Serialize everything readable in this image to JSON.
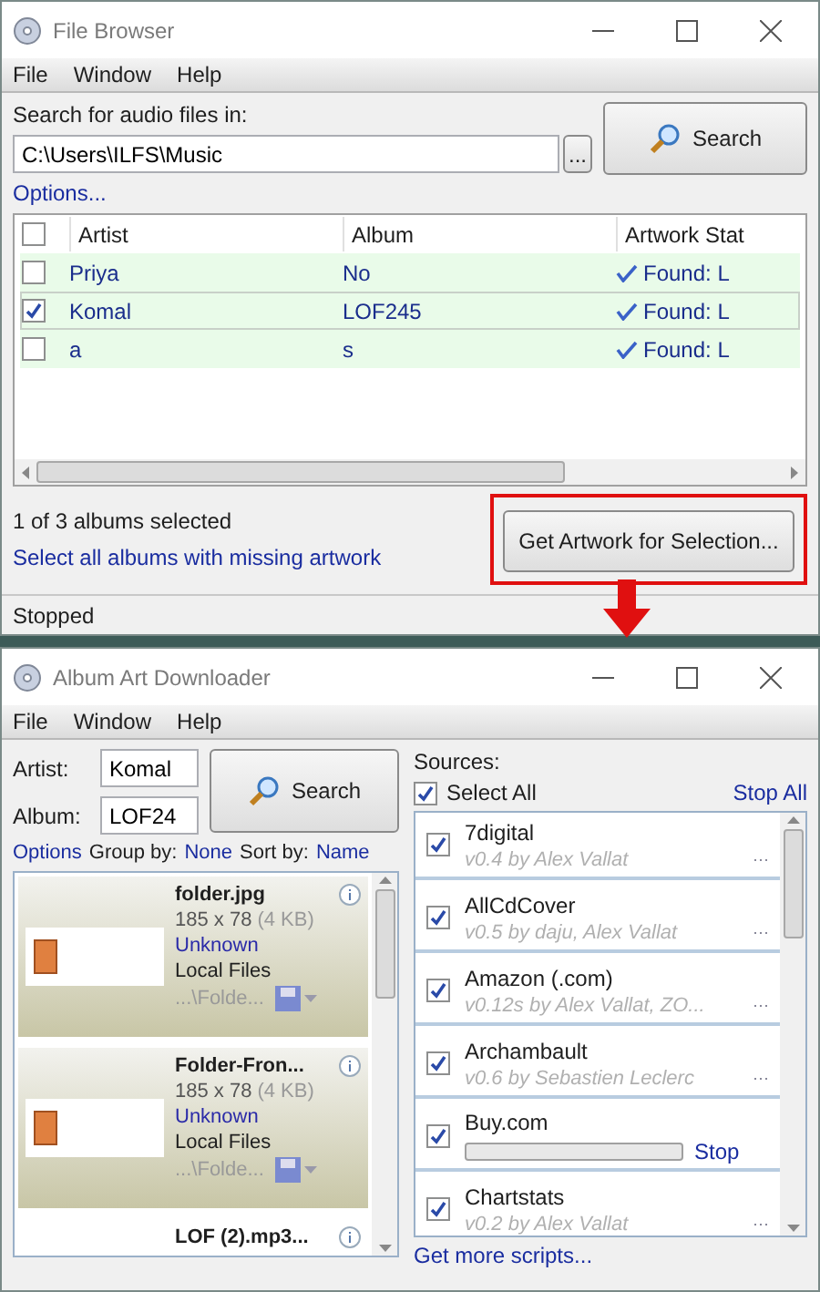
{
  "file_browser": {
    "title": "File Browser",
    "menu": [
      "File",
      "Window",
      "Help"
    ],
    "search_label": "Search for audio files in:",
    "path": "C:\\Users\\ILFS\\Music",
    "browse_button": "...",
    "search_button": "Search",
    "options_link": "Options...",
    "table": {
      "all_checked": false,
      "columns": [
        "Artist",
        "Album",
        "Artwork Stat"
      ],
      "rows": [
        {
          "checked": false,
          "artist": "Priya",
          "album": "No",
          "status": "Found: L"
        },
        {
          "checked": true,
          "artist": "Komal",
          "album": "LOF245",
          "status": "Found: L"
        },
        {
          "checked": false,
          "artist": "a",
          "album": "s",
          "status": "Found: L"
        }
      ]
    },
    "selection_count": "1 of 3 albums selected",
    "select_missing_link": "Select all albums with missing artwork",
    "get_artwork_button": "Get Artwork for Selection...",
    "status_bar": "Stopped"
  },
  "album_art_downloader": {
    "title": "Album Art Downloader",
    "menu": [
      "File",
      "Window",
      "Help"
    ],
    "artist_label": "Artist:",
    "artist_value": "Komal",
    "album_label": "Album:",
    "album_value": "LOF24",
    "search_button": "Search",
    "options_link": "Options",
    "group_by_label": "Group by:",
    "group_by_value": "None",
    "sort_by_label": "Sort by:",
    "sort_by_value": "Name",
    "results": [
      {
        "name": "folder.jpg",
        "dimensions": "185 x 78",
        "size": "(4 KB)",
        "type": "Unknown",
        "source": "Local Files",
        "path": "...\\Folde..."
      },
      {
        "name": "Folder-Fron...",
        "dimensions": "185 x 78",
        "size": "(4 KB)",
        "type": "Unknown",
        "source": "Local Files",
        "path": "...\\Folde..."
      },
      {
        "name": "LOF (2).mp3..."
      }
    ],
    "sources_label": "Sources:",
    "select_all": {
      "label": "Select All",
      "checked": true
    },
    "stop_all_link": "Stop All",
    "sources": [
      {
        "kind": "info",
        "checked": true,
        "name": "7digital",
        "detail": "v0.4 by Alex Vallat"
      },
      {
        "kind": "info",
        "checked": true,
        "name": "AllCdCover",
        "detail": "v0.5 by daju, Alex Vallat"
      },
      {
        "kind": "info",
        "checked": true,
        "name": "Amazon (.com)",
        "detail": "v0.12s by Alex Vallat, ZO..."
      },
      {
        "kind": "info",
        "checked": true,
        "name": "Archambault",
        "detail": "v0.6 by Sebastien Leclerc"
      },
      {
        "kind": "progress",
        "checked": true,
        "name": "Buy.com",
        "level": 0,
        "stop_link": "Stop"
      },
      {
        "kind": "info",
        "checked": true,
        "name": "Chartstats",
        "detail": "v0.2 by Alex Vallat"
      }
    ],
    "more_scripts_link": "Get more scripts..."
  }
}
